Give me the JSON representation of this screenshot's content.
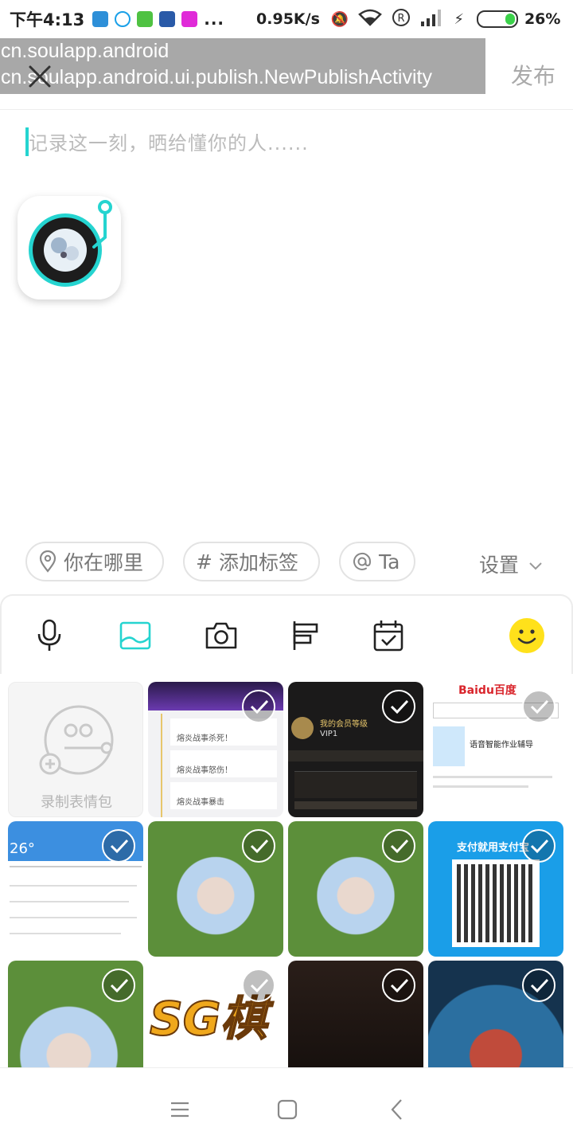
{
  "status_bar": {
    "time": "下午4:13",
    "dots": "...",
    "network_speed": "0.95K/s",
    "battery_pct": "26%"
  },
  "header": {
    "debug_package": "cn.soulapp.android",
    "debug_activity": "cn.soulapp.android.ui.publish.NewPublishActivity",
    "publish_label": "发布"
  },
  "composer": {
    "placeholder": "记录这一刻，晒给懂你的人......"
  },
  "chips": {
    "location": "你在哪里",
    "tag_hash": "#",
    "tag": "添加标签",
    "mention": "Ta",
    "settings": "设置"
  },
  "toolbar": {
    "icons": [
      "mic-icon",
      "image-icon",
      "camera-icon",
      "vote-icon",
      "calendar-icon",
      "emoji-icon"
    ],
    "accent": "#25d4d0"
  },
  "gallery": {
    "record_emoji_label": "录制表情包",
    "thumb_texts": {
      "t1_row1": "熔炎战事杀死！",
      "t1_row2": "熔炎战事怒伤！",
      "t1_row3": "熔炎战事暴击",
      "t2_title": "我的会员等级",
      "t2_sub": "VIP1",
      "t3_logo": "Baidu百度",
      "t3_text": "语音智能作业辅导",
      "t4_header": "26°",
      "t5_title": "支付就用支付宝",
      "t6_text": "SG棋"
    }
  },
  "navbar": {
    "icons": [
      "menu-icon",
      "home-icon",
      "back-icon"
    ]
  }
}
